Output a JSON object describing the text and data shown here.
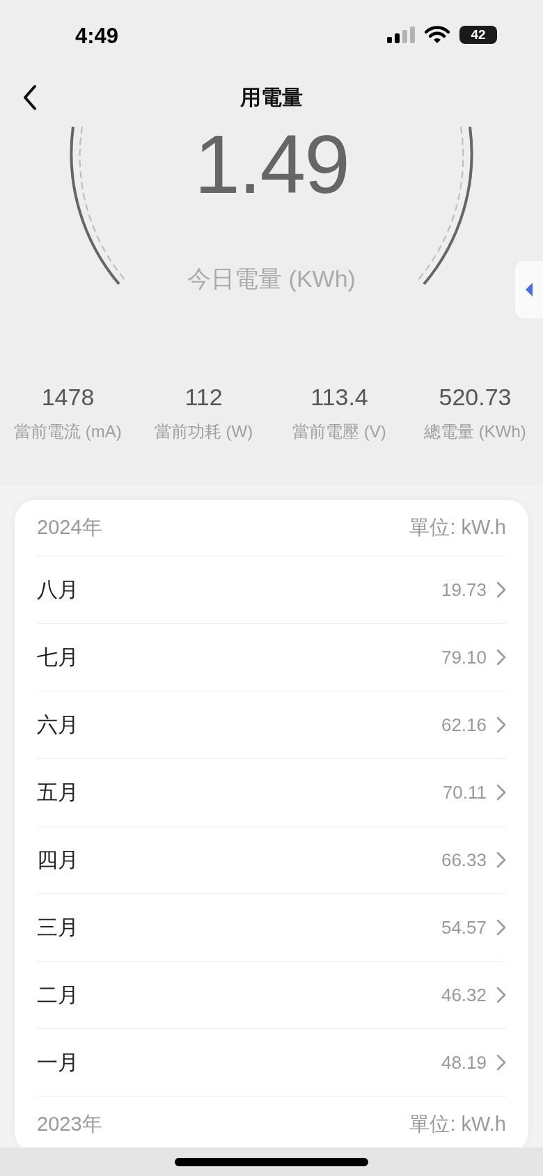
{
  "status_bar": {
    "time": "4:49",
    "battery": "42"
  },
  "nav": {
    "title": "用電量"
  },
  "gauge": {
    "value": "1.49",
    "label": "今日電量 (KWh)"
  },
  "stats": [
    {
      "value": "1478",
      "label": "當前電流 (mA)"
    },
    {
      "value": "112",
      "label": "當前功耗 (W)"
    },
    {
      "value": "113.4",
      "label": "當前電壓 (V)"
    },
    {
      "value": "520.73",
      "label": "總電量 (KWh)"
    }
  ],
  "years": [
    {
      "year": "2024年",
      "unit": "單位: kW.h",
      "months": [
        {
          "name": "八月",
          "value": "19.73"
        },
        {
          "name": "七月",
          "value": "79.10"
        },
        {
          "name": "六月",
          "value": "62.16"
        },
        {
          "name": "五月",
          "value": "70.11"
        },
        {
          "name": "四月",
          "value": "66.33"
        },
        {
          "name": "三月",
          "value": "54.57"
        },
        {
          "name": "二月",
          "value": "46.32"
        },
        {
          "name": "一月",
          "value": "48.19"
        }
      ]
    },
    {
      "year": "2023年",
      "unit": "單位: kW.h"
    }
  ]
}
